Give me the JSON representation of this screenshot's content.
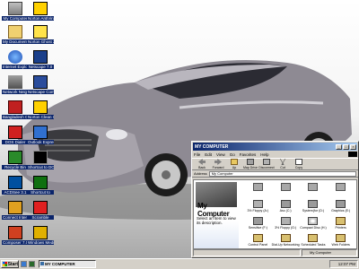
{
  "colors": {
    "title_bar": "#0a246a",
    "selection": "#0a246a",
    "window_face": "#d4d0c8"
  },
  "desktop_icons": [
    {
      "label": "My Computer",
      "icon": "my-computer-icon"
    },
    {
      "label": "Norton AntiVirus",
      "icon": "norton-antivirus-icon"
    },
    {
      "label": "My Documents",
      "icon": "my-documents-icon"
    },
    {
      "label": "Norton Ghost 2003",
      "icon": "norton-ghost-icon"
    },
    {
      "label": "Internet Explorer",
      "icon": "internet-explorer-icon"
    },
    {
      "label": "Netscape 7.0",
      "icon": "netscape-icon"
    },
    {
      "label": "Network Neighborhood",
      "icon": "network-neighborhood-icon"
    },
    {
      "label": "Netscape Communicator",
      "icon": "netscape-communicator-icon"
    },
    {
      "label": "Bangladesh Online Limited",
      "icon": "bangladesh-online-icon"
    },
    {
      "label": "Norton Clean Sweep",
      "icon": "norton-clean-sweep-icon"
    },
    {
      "label": "DOS Dialer",
      "icon": "dos-dialer-icon"
    },
    {
      "label": "Outlook Express",
      "icon": "outlook-express-icon"
    },
    {
      "label": "Recycle Bin",
      "icon": "recycle-bin-icon"
    },
    {
      "label": "Shortcut to DOS box",
      "icon": "dos-box-icon"
    },
    {
      "label": "ACDSee 3.1",
      "icon": "acdsee-icon"
    },
    {
      "label": "Shortcut to",
      "icon": "shortcut-icon"
    },
    {
      "label": "Connect Internet",
      "icon": "connect-internet-icon"
    },
    {
      "label": "Scramble",
      "icon": "scramble-icon"
    },
    {
      "label": "Composer 7.0",
      "icon": "composer-icon"
    },
    {
      "label": "Windows Media Player",
      "icon": "windows-media-player-icon"
    }
  ],
  "window": {
    "title": "MY COMPUTER",
    "menu": [
      "File",
      "Edit",
      "View",
      "Go",
      "Favorites",
      "Help"
    ],
    "toolbar": [
      {
        "label": "Back",
        "icon": "back-arrow-icon"
      },
      {
        "label": "Forward",
        "icon": "forward-arrow-icon"
      },
      {
        "label": "Up",
        "icon": "up-folder-icon"
      },
      {
        "label": "Map Drive",
        "icon": "map-drive-icon"
      },
      {
        "label": "Disconnect",
        "icon": "disconnect-icon"
      },
      {
        "label": "Cut",
        "icon": "cut-icon"
      },
      {
        "label": "Copy",
        "icon": "copy-icon"
      }
    ],
    "address_label": "Address",
    "address_value": "My Computer",
    "left_title": "My Computer",
    "left_desc": "Select an item to view its description.",
    "items": [
      {
        "label": "",
        "icon": "drive-icon"
      },
      {
        "label": "",
        "icon": "drive-icon"
      },
      {
        "label": "",
        "icon": "drive-icon"
      },
      {
        "label": "",
        "icon": "drive-icon"
      },
      {
        "label": "3½ Floppy (A:)",
        "icon": "floppy-drive-icon"
      },
      {
        "label": "Asc (C:)",
        "icon": "hard-drive-icon"
      },
      {
        "label": "System(for (D:)",
        "icon": "hard-drive-icon"
      },
      {
        "label": "Graphics (E:)",
        "icon": "hard-drive-icon"
      },
      {
        "label": "Sensitive (F:)",
        "icon": "hard-drive-icon"
      },
      {
        "label": "3½ Floppy (G:)",
        "icon": "floppy-drive-icon"
      },
      {
        "label": "Compact Disc (H:)",
        "icon": "cd-drive-icon"
      },
      {
        "label": "Printers",
        "icon": "printers-icon"
      },
      {
        "label": "Control Panel",
        "icon": "control-panel-icon"
      },
      {
        "label": "Dial-Up Networking",
        "icon": "dial-up-networking-icon"
      },
      {
        "label": "Scheduled Tasks",
        "icon": "scheduled-tasks-icon"
      },
      {
        "label": "Web Folders",
        "icon": "web-folders-icon"
      }
    ],
    "status_right": "My Computer"
  },
  "taskbar": {
    "start_label": "Start",
    "task_label": "MY COMPUTER",
    "clock": "12:07 PM"
  }
}
